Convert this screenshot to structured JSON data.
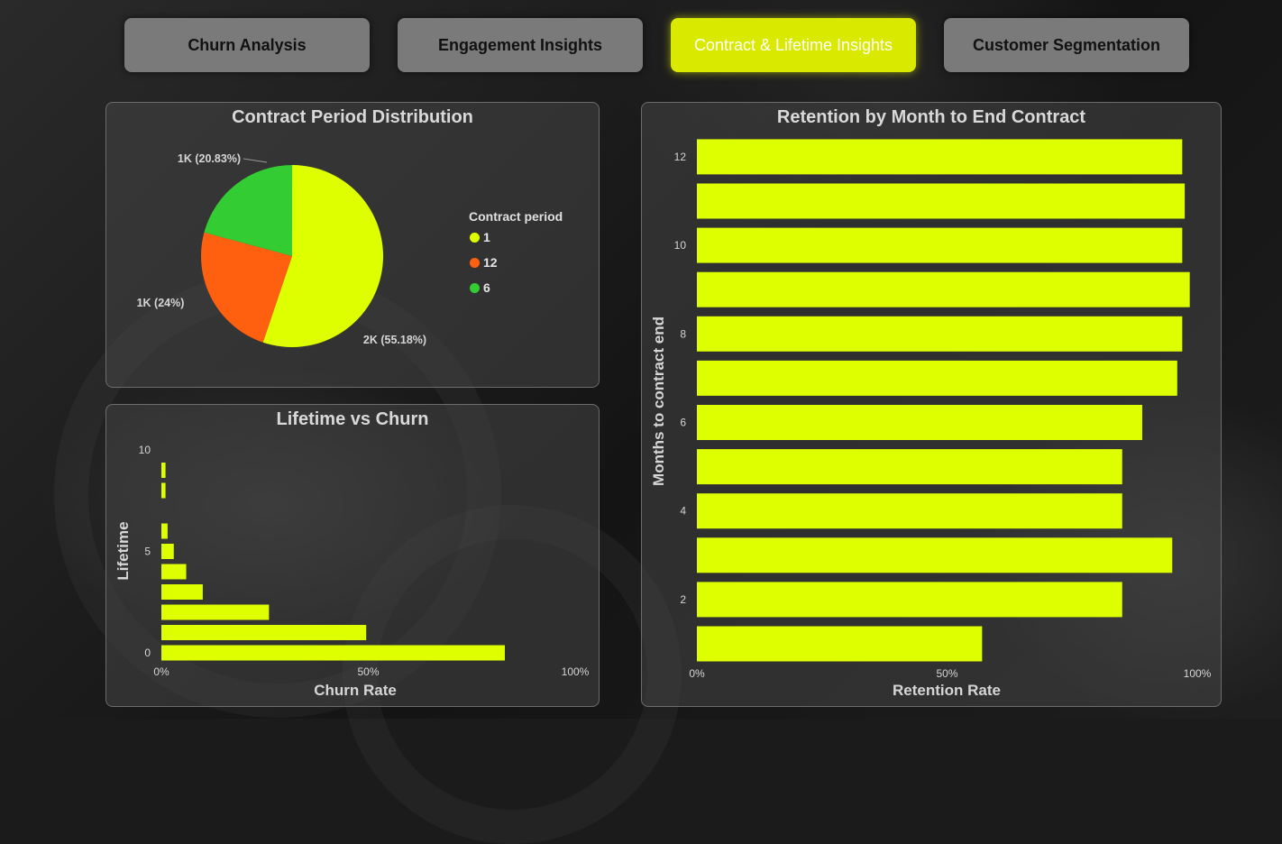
{
  "colors": {
    "accent": "#d9ea00",
    "bar": "#ddff00",
    "pie_1": "#ddff00",
    "pie_12": "#ff6010",
    "pie_6": "#33cc33",
    "tab_inactive": "#7a7a7a"
  },
  "tabs": [
    {
      "label": "Churn Analysis",
      "active": false
    },
    {
      "label": "Engagement Insights",
      "active": false
    },
    {
      "label": "Contract & Lifetime Insights",
      "active": true
    },
    {
      "label": "Customer Segmentation",
      "active": false
    }
  ],
  "pie_panel": {
    "title": "Contract Period Distribution"
  },
  "lifetime_panel": {
    "title": "Lifetime vs Churn"
  },
  "retention_panel": {
    "title": "Retention by Month to End Contract"
  },
  "chart_data": [
    {
      "type": "pie",
      "title": "Contract Period Distribution",
      "legend_title": "Contract period",
      "legend_position": "right",
      "slices": [
        {
          "label": "1",
          "percent": 55.18,
          "data_label": "2K (55.18%)",
          "color": "#ddff00"
        },
        {
          "label": "12",
          "percent": 24.0,
          "data_label": "1K (24%)",
          "color": "#ff6010"
        },
        {
          "label": "6",
          "percent": 20.83,
          "data_label": "1K (20.83%)",
          "color": "#33cc33"
        }
      ]
    },
    {
      "type": "bar",
      "orientation": "horizontal",
      "title": "Lifetime vs Churn",
      "xlabel": "Churn Rate",
      "ylabel": "Lifetime",
      "xlim": [
        0,
        100
      ],
      "x_ticks": [
        "0%",
        "50%",
        "100%"
      ],
      "y_ticks": [
        "0",
        "5",
        "10"
      ],
      "categories": [
        0,
        1,
        2,
        3,
        4,
        5,
        6,
        8,
        9
      ],
      "values": [
        83,
        49.5,
        26,
        10,
        6,
        3,
        1.5,
        1,
        1
      ]
    },
    {
      "type": "bar",
      "orientation": "horizontal",
      "title": "Retention by Month to End Contract",
      "xlabel": "Retention Rate",
      "ylabel": "Months to contract end",
      "xlim": [
        0,
        100
      ],
      "x_ticks": [
        "0%",
        "50%",
        "100%"
      ],
      "y_ticks": [
        "2",
        "4",
        "6",
        "8",
        "10",
        "12"
      ],
      "categories": [
        1,
        2,
        3,
        4,
        5,
        6,
        7,
        8,
        9,
        10,
        11,
        12
      ],
      "values": [
        57,
        85,
        95,
        85,
        85,
        89,
        96,
        97,
        98.5,
        97,
        97.5,
        97
      ]
    }
  ]
}
